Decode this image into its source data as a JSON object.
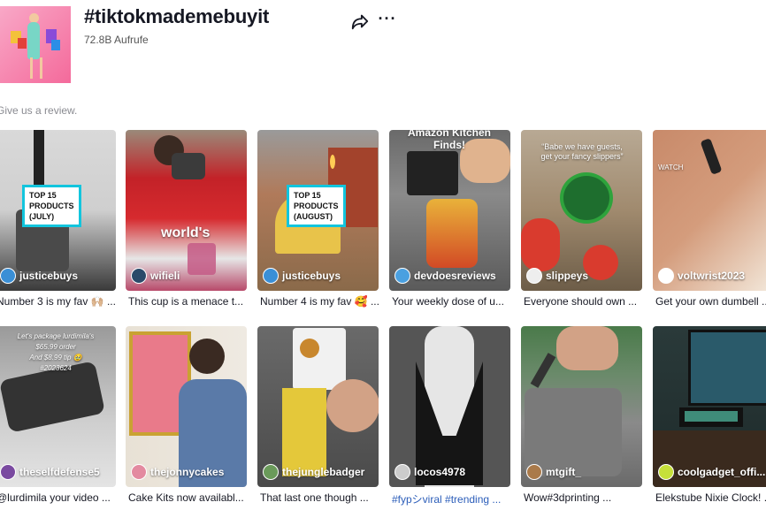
{
  "header": {
    "title": "#tiktokmademebuyit",
    "views": "72.8B Aufrufe"
  },
  "review_text": "Give us a review.",
  "icons": {
    "share": "share-arrow-icon",
    "more": "more-dots-icon"
  },
  "videos": [
    {
      "username": "justicebuys",
      "caption": "Number 3 is my fav 🙌🏼 ...",
      "overlay": "TOP 15\nPRODUCTS\n(JULY)",
      "overlay_type": "badge"
    },
    {
      "username": "wifieli",
      "caption": "This cup is a menace t...",
      "overlay": "world's",
      "overlay_type": "text"
    },
    {
      "username": "justicebuys",
      "caption": "Number 4 is my fav 🥰 ...",
      "overlay": "TOP 15\nPRODUCTS\n(AUGUST)",
      "overlay_type": "badge"
    },
    {
      "username": "devdoesreviews",
      "caption": "Your weekly dose of u...",
      "overlay": "Amazon Kitchen\nFinds!",
      "overlay_type": "text"
    },
    {
      "username": "slippeys",
      "caption": "Everyone should own ...",
      "overlay": "“Babe we have guests,\nget your fancy slippers”",
      "overlay_type": "text"
    },
    {
      "username": "voltwrist2023",
      "caption": "Get your own dumbell ...",
      "overlay": "WATCH",
      "overlay_type": "text"
    },
    {
      "username": "theselfdefense5",
      "caption": "@lurdimila your video ...",
      "overlay": "Let's package lurdimila's\n$65.99 order\nAnd $8.99 tip 🥹\n#2023624",
      "overlay_type": "text"
    },
    {
      "username": "thejonnycakes",
      "caption": "Cake Kits now availabl...",
      "overlay": "",
      "overlay_type": "none"
    },
    {
      "username": "thejunglebadger",
      "caption": "That last one though ...",
      "overlay": "",
      "overlay_type": "none"
    },
    {
      "username": "locos4978",
      "caption": "#fypシviral #trending ...",
      "overlay": "",
      "overlay_type": "none"
    },
    {
      "username": "mtgift_",
      "caption": "Wow#3dprinting ...",
      "overlay": "",
      "overlay_type": "none"
    },
    {
      "username": "coolgadget_offi...",
      "caption": "Elekstube Nixie Clock! ...",
      "overlay": "",
      "overlay_type": "none"
    }
  ],
  "colors": {
    "accent_badge": "#12c5dd",
    "hashtag": "#2b5db9"
  }
}
